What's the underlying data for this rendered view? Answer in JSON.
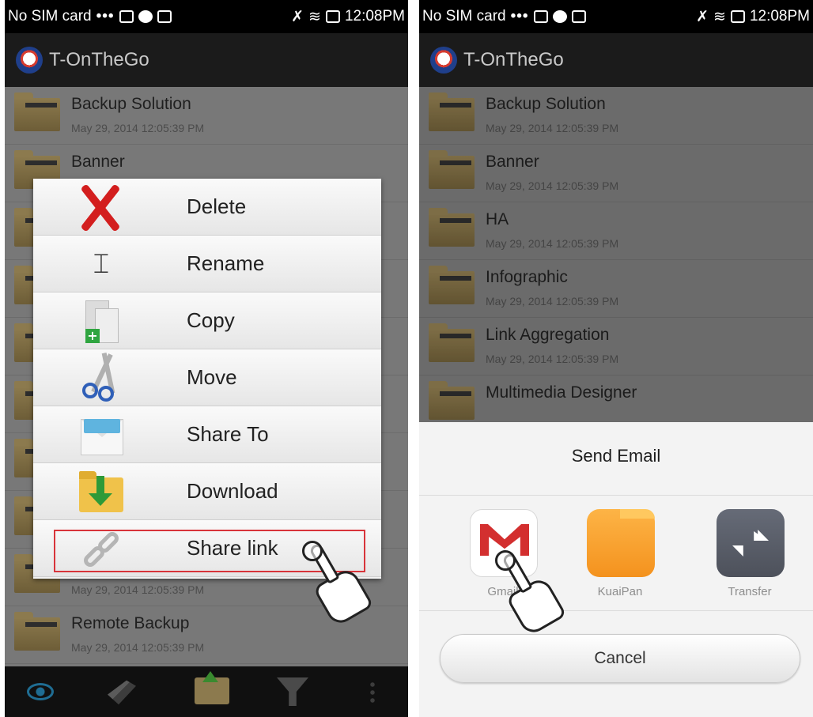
{
  "status_bar": {
    "carrier": "No SIM card",
    "dots": "•••",
    "time": "12:08PM"
  },
  "app": {
    "title": "T-OnTheGo"
  },
  "left_screen": {
    "files": [
      {
        "name": "Backup Solution",
        "date": "May 29, 2014 12:05:39 PM"
      },
      {
        "name": "Banner",
        "date": ""
      },
      {
        "name": "",
        "date": ""
      },
      {
        "name": "",
        "date": ""
      },
      {
        "name": "",
        "date": ""
      },
      {
        "name": "",
        "date": ""
      },
      {
        "name": "",
        "date": ""
      },
      {
        "name": "",
        "date": ""
      },
      {
        "name": "",
        "date": "May 29, 2014 12:05:39 PM"
      },
      {
        "name": "Remote Backup",
        "date": "May 29, 2014 12:05:39 PM"
      }
    ],
    "context_menu": {
      "items": [
        {
          "label": "Delete",
          "icon": "delete-icon"
        },
        {
          "label": "Rename",
          "icon": "rename-icon"
        },
        {
          "label": "Copy",
          "icon": "copy-icon"
        },
        {
          "label": "Move",
          "icon": "scissors-icon"
        },
        {
          "label": "Share To",
          "icon": "envelope-icon"
        },
        {
          "label": "Download",
          "icon": "download-folder-icon"
        },
        {
          "label": "Share link",
          "icon": "chain-link-icon"
        }
      ],
      "highlight_color": "#d8343a"
    },
    "bottom_bar": {
      "icons": [
        "eye-icon",
        "edit-icon",
        "upload-folder-icon",
        "filter-icon",
        "more-icon"
      ]
    }
  },
  "right_screen": {
    "files": [
      {
        "name": "Backup Solution",
        "date": "May 29, 2014 12:05:39 PM"
      },
      {
        "name": "Banner",
        "date": "May 29, 2014 12:05:39 PM"
      },
      {
        "name": "HA",
        "date": "May 29, 2014 12:05:39 PM"
      },
      {
        "name": "Infographic",
        "date": "May 29, 2014 12:05:39 PM"
      },
      {
        "name": "Link Aggregation",
        "date": "May 29, 2014 12:05:39 PM"
      },
      {
        "name": "Multimedia Designer",
        "date": ""
      }
    ],
    "share_sheet": {
      "title": "Send Email",
      "apps": [
        {
          "label": "Gmail",
          "icon": "gmail-icon"
        },
        {
          "label": "KuaiPan",
          "icon": "kuaipan-icon"
        },
        {
          "label": "Transfer",
          "icon": "transfer-icon"
        }
      ],
      "cancel_label": "Cancel"
    }
  }
}
